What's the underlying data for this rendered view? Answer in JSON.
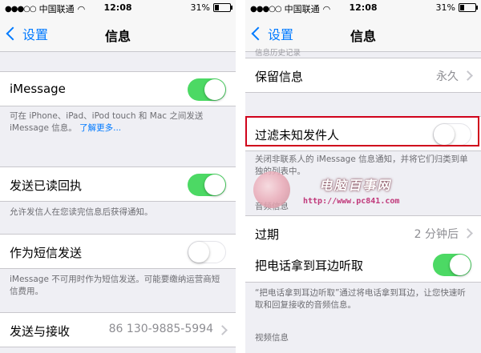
{
  "left": {
    "status": {
      "carrier": "中国联通",
      "time": "12:08",
      "battery": "31%",
      "battery_level": 0.31
    },
    "nav": {
      "back_label": "设置",
      "title": "信息"
    },
    "imessage": {
      "label": "iMessage",
      "toggle": "on"
    },
    "imessage_footer": {
      "text": "可在 iPhone、iPad、iPod touch 和 Mac 之间发送 iMessage 信息。",
      "link": "了解更多..."
    },
    "read_receipts": {
      "label": "发送已读回执",
      "toggle": "on"
    },
    "read_receipts_footer": "允许发信人在您读完信息后获得通知。",
    "send_as_sms": {
      "label": "作为短信发送",
      "toggle": "off"
    },
    "send_as_sms_footer": "iMessage 不可用时作为短信发送。可能要缴纳运营商短信费用。",
    "send_receive": {
      "label": "发送与接收",
      "value": "86 130-9885-5994"
    }
  },
  "right": {
    "status": {
      "carrier": "中国联通",
      "time": "12:08",
      "battery": "31%",
      "battery_level": 0.31
    },
    "nav": {
      "back_label": "设置",
      "title": "信息"
    },
    "history_header": "信息历史记录",
    "keep_messages": {
      "label": "保留信息",
      "value": "永久"
    },
    "filter_unknown": {
      "label": "过滤未知发件人",
      "toggle": "off"
    },
    "filter_footer": "关闭非联系人的 iMessage 信息通知，并将它们归类到单独的列表中。",
    "audio_header": "音频信息",
    "expire": {
      "label": "过期",
      "value": "2 分钟后"
    },
    "raise_to_listen": {
      "label": "把电话拿到耳边听取",
      "toggle": "on"
    },
    "raise_footer": "“把电话拿到耳边听取”通过将电话拿到耳边，让您快速听取和回复接收的音频信息。",
    "video_header": "视频信息"
  },
  "watermark": {
    "title": "电脑百事网",
    "url": "http://www.pc841.com"
  }
}
